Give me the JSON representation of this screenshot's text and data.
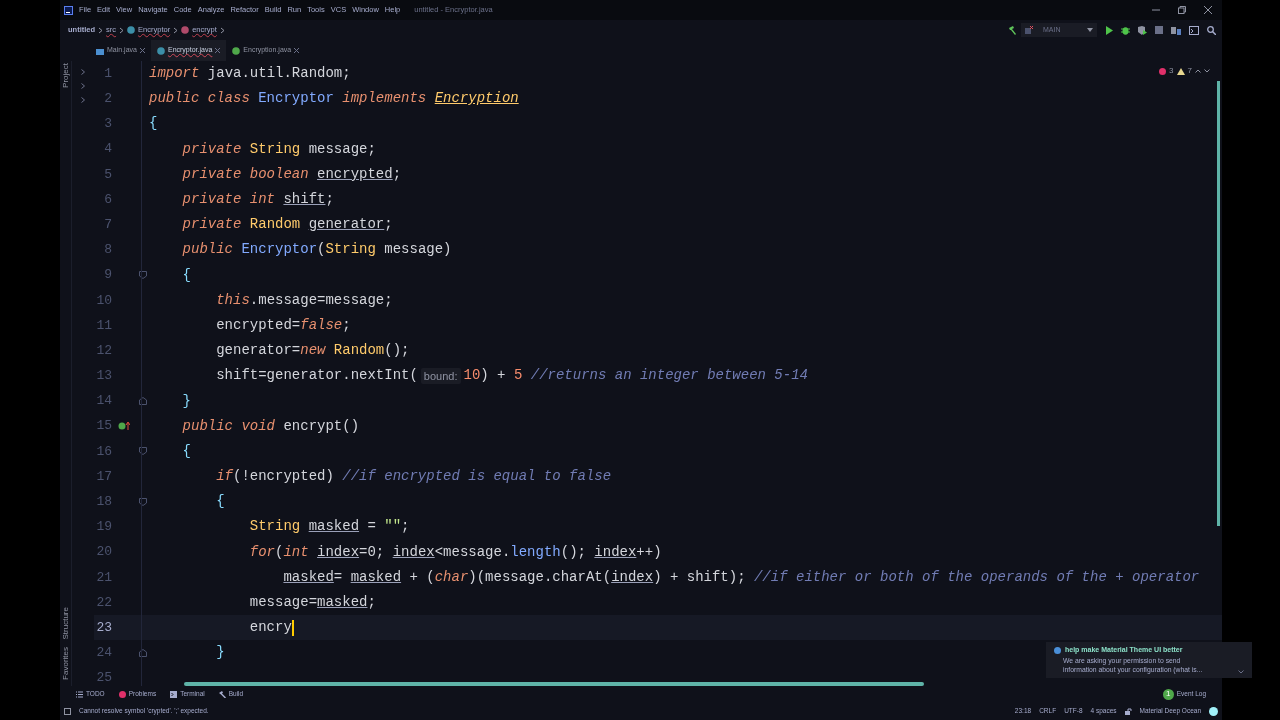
{
  "window": {
    "title": "untitled - Encryptor.java"
  },
  "menu": [
    "File",
    "Edit",
    "View",
    "Navigate",
    "Code",
    "Analyze",
    "Refactor",
    "Build",
    "Run",
    "Tools",
    "VCS",
    "Window",
    "Help"
  ],
  "breadcrumbs": [
    {
      "label": "untitled",
      "kind": "project"
    },
    {
      "label": "src",
      "kind": "folder"
    },
    {
      "label": "Encryptor",
      "kind": "class"
    },
    {
      "label": "encrypt",
      "kind": "method"
    }
  ],
  "run_config": {
    "label": "MAIN"
  },
  "tabs": [
    {
      "label": "Main.java",
      "kind": "main",
      "selected": false
    },
    {
      "label": "Encryptor.java",
      "kind": "class",
      "selected": true
    },
    {
      "label": "Encryption.java",
      "kind": "interface",
      "selected": false
    }
  ],
  "side_tools": [
    {
      "label": "Project",
      "kind": "top"
    },
    {
      "label": "Structure",
      "kind": "bottom"
    },
    {
      "label": "Favorites",
      "kind": "bottom"
    }
  ],
  "inspections": {
    "errors": "3",
    "warnings": "7"
  },
  "editor": {
    "lines": [
      {
        "n": "1",
        "kind": "plain",
        "current": false,
        "tokens": [
          {
            "kind": "kw",
            "text": "import"
          },
          {
            "kind": "pl",
            "text": " java.util.Random;"
          }
        ]
      },
      {
        "n": "2",
        "kind": "plain",
        "current": false,
        "tokens": [
          {
            "kind": "kw",
            "text": "public class "
          },
          {
            "kind": "cls",
            "text": "Encryptor"
          },
          {
            "kind": "kw",
            "text": " implements "
          },
          {
            "kind": "iface",
            "text": "Encryption"
          }
        ]
      },
      {
        "n": "3",
        "kind": "plain",
        "current": false,
        "tokens": [
          {
            "kind": "br",
            "text": "{"
          }
        ]
      },
      {
        "n": "4",
        "kind": "plain",
        "current": false,
        "tokens": [
          {
            "kind": "kw",
            "text": "    private "
          },
          {
            "kind": "ty",
            "text": "String"
          },
          {
            "kind": "pl",
            "text": " message;"
          }
        ]
      },
      {
        "n": "5",
        "kind": "plain",
        "current": false,
        "tokens": [
          {
            "kind": "kw",
            "text": "    private boolean "
          },
          {
            "kind": "fd",
            "text": "encrypted"
          },
          {
            "kind": "pl",
            "text": ";"
          }
        ]
      },
      {
        "n": "6",
        "kind": "plain",
        "current": false,
        "tokens": [
          {
            "kind": "kw",
            "text": "    private int "
          },
          {
            "kind": "fd",
            "text": "shift"
          },
          {
            "kind": "pl",
            "text": ";"
          }
        ]
      },
      {
        "n": "7",
        "kind": "plain",
        "current": false,
        "tokens": [
          {
            "kind": "kw",
            "text": "    private "
          },
          {
            "kind": "ty",
            "text": "Random "
          },
          {
            "kind": "fd",
            "text": "generator"
          },
          {
            "kind": "pl",
            "text": ";"
          }
        ]
      },
      {
        "n": "8",
        "kind": "plain",
        "current": false,
        "tokens": [
          {
            "kind": "kw",
            "text": "    public "
          },
          {
            "kind": "cls",
            "text": "Encryptor"
          },
          {
            "kind": "pl",
            "text": "("
          },
          {
            "kind": "ty",
            "text": "String"
          },
          {
            "kind": "pl",
            "text": " message)"
          }
        ]
      },
      {
        "n": "9",
        "kind": "fold-open",
        "current": false,
        "tokens": [
          {
            "kind": "br",
            "text": "    {"
          }
        ]
      },
      {
        "n": "10",
        "kind": "plain",
        "current": false,
        "tokens": [
          {
            "kind": "kw",
            "text": "        this"
          },
          {
            "kind": "pl",
            "text": ".message=message;"
          }
        ]
      },
      {
        "n": "11",
        "kind": "plain",
        "current": false,
        "tokens": [
          {
            "kind": "pl",
            "text": "        encrypted="
          },
          {
            "kind": "kw",
            "text": "false"
          },
          {
            "kind": "pl",
            "text": ";"
          }
        ]
      },
      {
        "n": "12",
        "kind": "plain",
        "current": false,
        "tokens": [
          {
            "kind": "pl",
            "text": "        generator="
          },
          {
            "kind": "kw",
            "text": "new "
          },
          {
            "kind": "ty",
            "text": "Random"
          },
          {
            "kind": "pl",
            "text": "();"
          }
        ]
      },
      {
        "n": "13",
        "kind": "plain",
        "current": false,
        "tokens": [
          {
            "kind": "pl",
            "text": "        shift=generator.nextInt("
          },
          {
            "kind": "hint",
            "text": "bound:"
          },
          {
            "kind": "num",
            "text": "10"
          },
          {
            "kind": "pl",
            "text": ") + "
          },
          {
            "kind": "num",
            "text": "5"
          },
          {
            "kind": "cm",
            "text": " //returns an integer between 5-14"
          }
        ]
      },
      {
        "n": "14",
        "kind": "fold-close",
        "current": false,
        "tokens": [
          {
            "kind": "br",
            "text": "    }"
          }
        ]
      },
      {
        "n": "15",
        "kind": "override",
        "current": false,
        "tokens": [
          {
            "kind": "kw",
            "text": "    public void "
          },
          {
            "kind": "pl",
            "text": "encrypt()"
          }
        ]
      },
      {
        "n": "16",
        "kind": "fold-open",
        "current": false,
        "tokens": [
          {
            "kind": "br",
            "text": "    {"
          }
        ]
      },
      {
        "n": "17",
        "kind": "plain",
        "current": false,
        "tokens": [
          {
            "kind": "kw",
            "text": "        if"
          },
          {
            "kind": "pl",
            "text": "(!encrypted) "
          },
          {
            "kind": "cm",
            "text": "//if encrypted is equal to false"
          }
        ]
      },
      {
        "n": "18",
        "kind": "fold-open",
        "current": false,
        "tokens": [
          {
            "kind": "br",
            "text": "        {"
          }
        ]
      },
      {
        "n": "19",
        "kind": "plain",
        "current": false,
        "tokens": [
          {
            "kind": "ty",
            "text": "            String "
          },
          {
            "kind": "fd",
            "text": "masked"
          },
          {
            "kind": "pl",
            "text": " = "
          },
          {
            "kind": "st",
            "text": "\"\""
          },
          {
            "kind": "pl",
            "text": ";"
          }
        ]
      },
      {
        "n": "20",
        "kind": "plain",
        "current": false,
        "tokens": [
          {
            "kind": "kw",
            "text": "            for"
          },
          {
            "kind": "pl",
            "text": "("
          },
          {
            "kind": "kw",
            "text": "int "
          },
          {
            "kind": "fd",
            "text": "index"
          },
          {
            "kind": "pl",
            "text": "=0; "
          },
          {
            "kind": "fd",
            "text": "index"
          },
          {
            "kind": "pl",
            "text": "<message."
          },
          {
            "kind": "fn",
            "text": "length"
          },
          {
            "kind": "pl",
            "text": "(); "
          },
          {
            "kind": "fd",
            "text": "index"
          },
          {
            "kind": "pl",
            "text": "++)"
          }
        ]
      },
      {
        "n": "21",
        "kind": "plain",
        "current": false,
        "tokens": [
          {
            "kind": "fd",
            "text": "                masked"
          },
          {
            "kind": "pl",
            "text": "= "
          },
          {
            "kind": "fd",
            "text": "masked"
          },
          {
            "kind": "pl",
            "text": " + ("
          },
          {
            "kind": "kw",
            "text": "char"
          },
          {
            "kind": "pl",
            "text": ")(message.charAt("
          },
          {
            "kind": "fd",
            "text": "index"
          },
          {
            "kind": "pl",
            "text": ") + shift); "
          },
          {
            "kind": "cm",
            "text": "//if either or both of the operands of the + operator"
          }
        ]
      },
      {
        "n": "22",
        "kind": "plain",
        "current": false,
        "tokens": [
          {
            "kind": "pl",
            "text": "            message="
          },
          {
            "kind": "fd",
            "text": "masked"
          },
          {
            "kind": "pl",
            "text": ";"
          }
        ]
      },
      {
        "n": "23",
        "kind": "plain",
        "current": true,
        "tokens": [
          {
            "kind": "pl",
            "text": "            encry"
          }
        ]
      },
      {
        "n": "24",
        "kind": "fold-close",
        "current": false,
        "tokens": [
          {
            "kind": "br",
            "text": "        }"
          }
        ]
      },
      {
        "n": "25",
        "kind": "plain",
        "current": false
      }
    ]
  },
  "tool_windows": [
    {
      "label": "TODO",
      "kind": "todo"
    },
    {
      "label": "Problems",
      "kind": "problems"
    },
    {
      "label": "Terminal",
      "kind": "terminal"
    },
    {
      "label": "Build",
      "kind": "build"
    }
  ],
  "event_log": {
    "label": "Event Log",
    "count": "1"
  },
  "notification": {
    "title": "help make Material Theme UI better",
    "body_lines": [
      "We are asking your permission to send",
      "information about your configuration (what is..."
    ]
  },
  "status": {
    "message": "Cannot resolve symbol 'crypted'. ';' expected.",
    "items": [
      "23:18",
      "CRLF",
      "UTF-8",
      "4 spaces"
    ],
    "theme": "Material Deep Ocean"
  }
}
